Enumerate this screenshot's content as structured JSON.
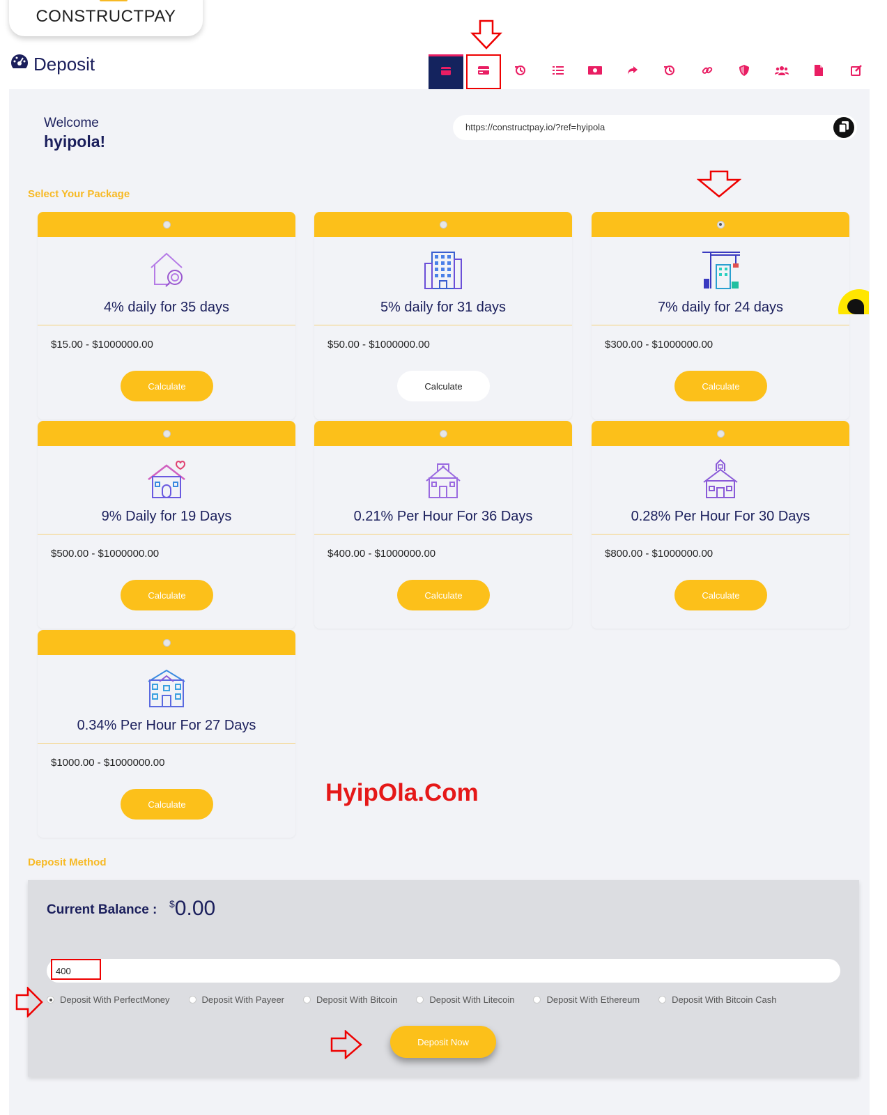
{
  "brand": {
    "name": "CONSTRUCTPAY"
  },
  "page": {
    "title": "Deposit"
  },
  "toolbar": {
    "icons": [
      "wallet-icon",
      "credit-card-icon",
      "history-icon",
      "list-icon",
      "money-icon",
      "share-icon",
      "history-icon",
      "link-icon",
      "shield-icon",
      "users-icon",
      "document-icon",
      "edit-icon"
    ]
  },
  "welcome": {
    "greeting": "Welcome",
    "username": "hyipola!"
  },
  "referral": {
    "url": "https://constructpay.io/?ref=hyipola"
  },
  "packages_section": {
    "label": "Select Your Package"
  },
  "packages": [
    {
      "title": "4% daily for 35 days",
      "range": "$15.00 - $1000000.00",
      "button": "Calculate",
      "icon": "house-search-icon",
      "selected": false
    },
    {
      "title": "5% daily for 31 days",
      "range": "$50.00 - $1000000.00",
      "button": "Calculate",
      "icon": "office-building-icon",
      "selected": false
    },
    {
      "title": "7% daily for 24 days",
      "range": "$300.00 - $1000000.00",
      "button": "Calculate",
      "icon": "construction-crane-icon",
      "selected": true
    },
    {
      "title": "9% Daily for 19 Days",
      "range": "$500.00 - $1000000.00",
      "button": "Calculate",
      "icon": "house-heart-icon",
      "selected": false
    },
    {
      "title": "0.21% Per Hour For 36 Days",
      "range": "$400.00 - $1000000.00",
      "button": "Calculate",
      "icon": "school-building-icon",
      "selected": false
    },
    {
      "title": "0.28% Per Hour For 30 Days",
      "range": "$800.00 - $1000000.00",
      "button": "Calculate",
      "icon": "church-building-icon",
      "selected": false
    },
    {
      "title": "0.34% Per Hour For 27 Days",
      "range": "$1000.00 - $1000000.00",
      "button": "Calculate",
      "icon": "mansion-icon",
      "selected": false
    }
  ],
  "watermark": {
    "text": "HyipOla.Com"
  },
  "deposit_section": {
    "label": "Deposit Method",
    "balance_label": "Current Balance :",
    "balance_currency": "$",
    "balance_value": "0.00",
    "amount_value": "400",
    "methods": [
      "Deposit With PerfectMoney",
      "Deposit With Payeer",
      "Deposit With Bitcoin",
      "Deposit With Litecoin",
      "Deposit With Ethereum",
      "Deposit With Bitcoin Cash"
    ],
    "selected_method": 0,
    "submit_label": "Deposit Now"
  },
  "colors": {
    "accent": "#fcc01a",
    "navy": "#1b1f5c",
    "pink": "#e91e63",
    "annotation": "#e00000"
  }
}
